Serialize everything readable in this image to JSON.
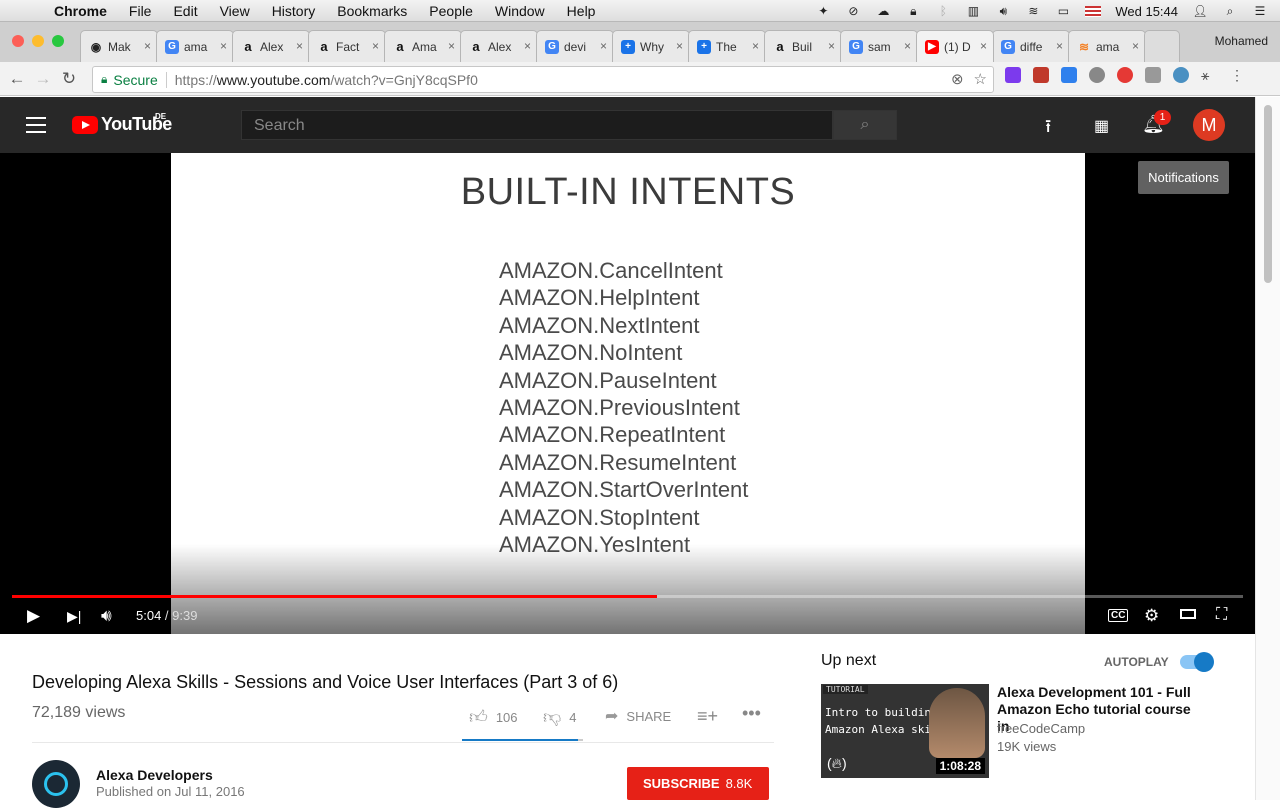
{
  "menubar": {
    "app": "Chrome",
    "items": [
      "File",
      "Edit",
      "View",
      "History",
      "Bookmarks",
      "People",
      "Window",
      "Help"
    ],
    "clock": "Wed 15:44"
  },
  "tabs": [
    {
      "label": "Mak",
      "favicon": "eye-icon"
    },
    {
      "label": "ama",
      "favicon": "google-icon"
    },
    {
      "label": "Alex",
      "favicon": "amazon-icon"
    },
    {
      "label": "Fact",
      "favicon": "amazon-icon"
    },
    {
      "label": "Ama",
      "favicon": "amazon-icon"
    },
    {
      "label": "Alex",
      "favicon": "amazon-icon"
    },
    {
      "label": "devi",
      "favicon": "google-icon"
    },
    {
      "label": "Why",
      "favicon": "plus-icon"
    },
    {
      "label": "The",
      "favicon": "plus-icon"
    },
    {
      "label": "Buil",
      "favicon": "amazon-icon"
    },
    {
      "label": "sam",
      "favicon": "google-icon"
    },
    {
      "label": "(1) D",
      "favicon": "youtube-icon",
      "active": true
    },
    {
      "label": "diffe",
      "favicon": "google-icon"
    },
    {
      "label": "ama",
      "favicon": "stack-icon"
    }
  ],
  "profile_name": "Mohamed",
  "address": {
    "secure_label": "Secure",
    "url_scheme": "https://",
    "url_host": "www.youtube.com",
    "url_path": "/watch?v=GnjY8cqSPf0"
  },
  "youtube": {
    "logo_text": "YouTube",
    "region": "DE",
    "search_placeholder": "Search",
    "notification_count": "1",
    "avatar_letter": "M",
    "tooltip": "Notifications"
  },
  "slide": {
    "title": "BUILT-IN INTENTS",
    "intents": [
      "AMAZON.CancelIntent",
      "AMAZON.HelpIntent",
      "AMAZON.NextIntent",
      "AMAZON.NoIntent",
      "AMAZON.PauseIntent",
      "AMAZON.PreviousIntent",
      "AMAZON.RepeatIntent",
      "AMAZON.ResumeIntent",
      "AMAZON.StartOverIntent",
      "AMAZON.StopIntent",
      "AMAZON.YesIntent"
    ]
  },
  "player": {
    "current_time": "5:04",
    "separator": " / ",
    "duration": "9:39",
    "progress_fraction": 0.524,
    "cc_label": "CC"
  },
  "video": {
    "title": "Developing Alexa Skills - Sessions and Voice User Interfaces (Part 3 of 6)",
    "views": "72,189 views",
    "likes": "106",
    "dislikes": "4",
    "share_label": "SHARE",
    "like_ratio": 0.96
  },
  "channel": {
    "name": "Alexa Developers",
    "published": "Published on Jul 11, 2016",
    "subscribe_label": "SUBSCRIBE",
    "subscriber_count": "8.8K"
  },
  "sidebar": {
    "up_next": "Up next",
    "autoplay": "AUTOPLAY",
    "recommendation": {
      "title": "Alexa Development 101 - Full Amazon Echo tutorial course in",
      "channel": "freeCodeCamp",
      "views": "19K views",
      "duration": "1:08:28",
      "thumb_tag": "TUTORIAL",
      "thumb_line1": "Intro to building",
      "thumb_line2": "Amazon Alexa skills"
    }
  },
  "colors": {
    "youtube_red": "#ff0000",
    "header_bg": "#282828",
    "subscribe_red": "#e62117",
    "autoplay_blue": "#167ac6"
  }
}
